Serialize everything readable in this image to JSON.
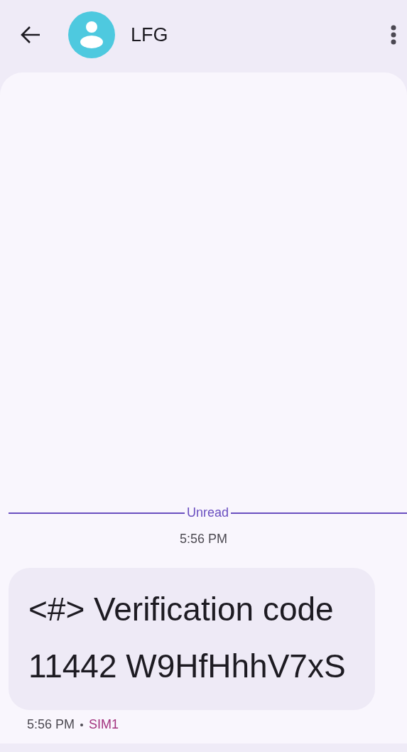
{
  "header": {
    "contact_name": "LFG"
  },
  "divider": {
    "label": "Unread"
  },
  "timestamp": "5:56 PM",
  "messages": [
    {
      "text": "<#> Verification code 11442 W9HfHhhV7xS",
      "time": "5:56 PM",
      "sim": "SIM1"
    }
  ]
}
